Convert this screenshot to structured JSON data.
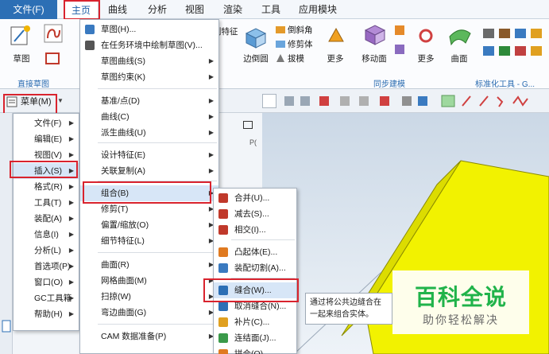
{
  "ribbon_tabs": {
    "file": "文件(F)",
    "home": "主页",
    "curve": "曲线",
    "analysis": "分析",
    "view": "视图",
    "render": "渲染",
    "tools": "工具",
    "app": "应用模块"
  },
  "ribbon": {
    "sketch": "草图",
    "direct_sketch_group": "直接草图",
    "edge_blend": "边倒圆",
    "more1": "更多",
    "move_face": "移动面",
    "more2": "更多",
    "surface": "曲面",
    "sync_group": "同步建模",
    "std_tools_group": "标准化工具 - G...",
    "chamfer": "倒斜角",
    "trim_body": "修剪体",
    "draft": "拔模",
    "feature_partial": "则特征"
  },
  "toolbar": {
    "menu_button": "菜单(M)"
  },
  "main_menu": [
    {
      "label": "文件(F)",
      "arrow": true
    },
    {
      "label": "编辑(E)",
      "arrow": true
    },
    {
      "label": "视图(V)",
      "arrow": true
    },
    {
      "label": "插入(S)",
      "arrow": true
    },
    {
      "label": "格式(R)",
      "arrow": true
    },
    {
      "label": "工具(T)",
      "arrow": true
    },
    {
      "label": "装配(A)",
      "arrow": true
    },
    {
      "label": "信息(I)",
      "arrow": true
    },
    {
      "label": "分析(L)",
      "arrow": true
    },
    {
      "label": "首选项(P)",
      "arrow": true
    },
    {
      "label": "窗口(O)",
      "arrow": true
    },
    {
      "label": "GC工具箱",
      "arrow": true
    },
    {
      "label": "帮助(H)",
      "arrow": true
    }
  ],
  "insert_menu": [
    {
      "label": "草图(H)...",
      "arrow": false
    },
    {
      "label": "在任务环境中绘制草图(V)...",
      "arrow": false
    },
    {
      "label": "草图曲线(S)",
      "arrow": true
    },
    {
      "label": "草图约束(K)",
      "arrow": true
    },
    {
      "label": "基准/点(D)",
      "arrow": true
    },
    {
      "label": "曲线(C)",
      "arrow": true
    },
    {
      "label": "派生曲线(U)",
      "arrow": true
    },
    {
      "label": "设计特征(E)",
      "arrow": true
    },
    {
      "label": "关联复制(A)",
      "arrow": true
    },
    {
      "label": "组合(B)",
      "arrow": true
    },
    {
      "label": "修剪(T)",
      "arrow": true
    },
    {
      "label": "偏置/缩放(O)",
      "arrow": true
    },
    {
      "label": "细节特征(L)",
      "arrow": true
    },
    {
      "label": "曲面(R)",
      "arrow": true
    },
    {
      "label": "网格曲面(M)",
      "arrow": true
    },
    {
      "label": "扫掠(W)",
      "arrow": true
    },
    {
      "label": "弯边曲面(G)",
      "arrow": true
    },
    {
      "label": "CAM 数据准备(P)",
      "arrow": true
    }
  ],
  "combine_menu": [
    {
      "label": "合并(U)..."
    },
    {
      "label": "减去(S)..."
    },
    {
      "label": "相交(I)..."
    },
    {
      "label": "凸起体(E)..."
    },
    {
      "label": "装配切割(A)..."
    },
    {
      "label": "缝合(W)..."
    },
    {
      "label": "取消缝合(N)..."
    },
    {
      "label": "补片(C)..."
    },
    {
      "label": "连结面(J)..."
    },
    {
      "label": "拼合(O)..."
    }
  ],
  "tooltip": "通过将公共边缝合在一起来组合实体。",
  "watermark": {
    "title": "百科全说",
    "subtitle": "助你轻松解决"
  },
  "colors": {
    "file_tab": "#2c6fb5",
    "highlight": "#d7e6f7",
    "annotation_red": "#d9232e",
    "model_yellow": "#f2f200"
  }
}
